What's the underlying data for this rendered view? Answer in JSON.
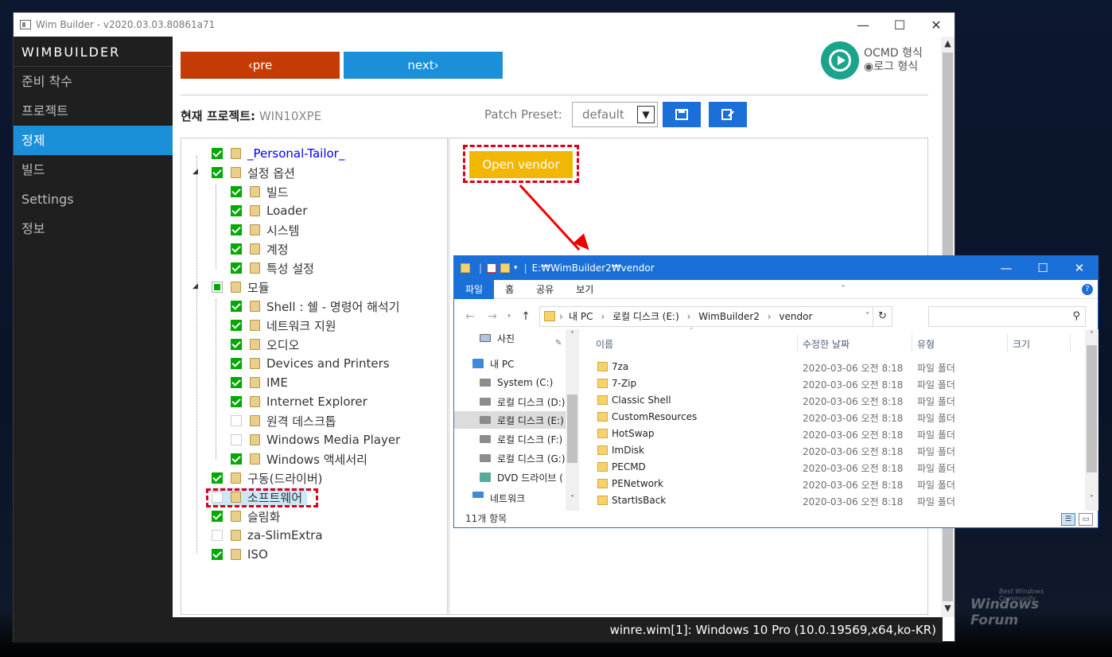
{
  "window": {
    "title": "Wim Builder - v2020.03.03.80861a71",
    "min": "—",
    "max": "☐",
    "close": "✕"
  },
  "sidebar": {
    "brand": "WIMBUILDER",
    "items": [
      {
        "label": "준비 착수"
      },
      {
        "label": "프로젝트"
      },
      {
        "label": "정제"
      },
      {
        "label": "빌드"
      },
      {
        "label": "Settings"
      },
      {
        "label": "정보"
      }
    ],
    "active_index": 2
  },
  "toolbar": {
    "pre_label": "‹pre",
    "next_label": "next›",
    "mode_ocmd": "OCMD 형식",
    "mode_log": "◉로그 형식"
  },
  "project": {
    "label": "현재 프로젝트:",
    "name": "WIN10XPE",
    "preset_label": "Patch Preset:",
    "preset_value": "default",
    "save_icon": "save-icon",
    "edit_icon": "edit-icon"
  },
  "tree": {
    "items": [
      {
        "label": "_Personal-Tailor_",
        "state": "on",
        "level": 0,
        "link": true
      },
      {
        "label": "설정 옵션",
        "state": "on",
        "level": 0
      },
      {
        "label": "빌드",
        "state": "on",
        "level": 1
      },
      {
        "label": "Loader",
        "state": "on",
        "level": 1
      },
      {
        "label": "시스템",
        "state": "on",
        "level": 1
      },
      {
        "label": "계정",
        "state": "on",
        "level": 1
      },
      {
        "label": "특성 설정",
        "state": "on",
        "level": 1
      },
      {
        "label": "모듈",
        "state": "partial",
        "level": 0
      },
      {
        "label": "Shell : 쉘 - 명령어 해석기",
        "state": "on",
        "level": 1
      },
      {
        "label": "네트워크 지원",
        "state": "on",
        "level": 1
      },
      {
        "label": "오디오",
        "state": "on",
        "level": 1
      },
      {
        "label": "Devices and Printers",
        "state": "on",
        "level": 1
      },
      {
        "label": "IME",
        "state": "on",
        "level": 1
      },
      {
        "label": "Internet Explorer",
        "state": "on",
        "level": 1
      },
      {
        "label": "원격 데스크톱",
        "state": "off",
        "level": 1
      },
      {
        "label": "Windows Media Player",
        "state": "off",
        "level": 1
      },
      {
        "label": "Windows 액세서리",
        "state": "on",
        "level": 1
      },
      {
        "label": "구동(드라이버)",
        "state": "on",
        "level": 0
      },
      {
        "label": "소프트웨어",
        "state": "off",
        "level": 0,
        "selected": true
      },
      {
        "label": "슬림화",
        "state": "on",
        "level": 0
      },
      {
        "label": "za-SlimExtra",
        "state": "off",
        "level": 0
      },
      {
        "label": "ISO",
        "state": "on",
        "level": 0
      }
    ]
  },
  "vendor_button": "Open vendor",
  "status": "winre.wim[1]: Windows 10 Pro (10.0.19569,x64,ko-KR)",
  "explorer": {
    "path": "E:₩WimBuilder2₩vendor",
    "tabs": [
      "파일",
      "홈",
      "공유",
      "보기"
    ],
    "breadcrumb": [
      "내 PC",
      "로컬 디스크 (E:)",
      "WimBuilder2",
      "vendor"
    ],
    "nav_items": [
      {
        "label": "사진",
        "icon": "image-icon"
      },
      {
        "label": "내 PC",
        "icon": "pc-icon"
      },
      {
        "label": "System (C:)",
        "icon": "drive-icon"
      },
      {
        "label": "로컬 디스크 (D:)",
        "icon": "drive-icon"
      },
      {
        "label": "로컬 디스크 (E:)",
        "icon": "drive-icon"
      },
      {
        "label": "로컬 디스크 (F:)",
        "icon": "drive-icon"
      },
      {
        "label": "로컬 디스크 (G:)",
        "icon": "drive-icon"
      },
      {
        "label": "DVD 드라이브 (",
        "icon": "dvd-icon"
      },
      {
        "label": "네트워크",
        "icon": "network-icon"
      }
    ],
    "columns": [
      "이름",
      "수정한 날짜",
      "유형",
      "크기"
    ],
    "files": [
      {
        "name": "7za",
        "date": "2020-03-06 오전 8:18",
        "type": "파일 폴더"
      },
      {
        "name": "7-Zip",
        "date": "2020-03-06 오전 8:18",
        "type": "파일 폴더"
      },
      {
        "name": "Classic Shell",
        "date": "2020-03-06 오전 8:18",
        "type": "파일 폴더"
      },
      {
        "name": "CustomResources",
        "date": "2020-03-06 오전 8:18",
        "type": "파일 폴더"
      },
      {
        "name": "HotSwap",
        "date": "2020-03-06 오전 8:18",
        "type": "파일 폴더"
      },
      {
        "name": "ImDisk",
        "date": "2020-03-06 오전 8:18",
        "type": "파일 폴더"
      },
      {
        "name": "PECMD",
        "date": "2020-03-06 오전 8:18",
        "type": "파일 폴더"
      },
      {
        "name": "PENetwork",
        "date": "2020-03-06 오전 8:18",
        "type": "파일 폴더"
      },
      {
        "name": "StartIsBack",
        "date": "2020-03-06 오전 8:18",
        "type": "파일 폴더"
      }
    ],
    "item_count": "11개 항목"
  },
  "watermark": {
    "main": "Windows Forum",
    "sub": "Best Windows Community"
  },
  "colors": {
    "accent": "#1b8fd8",
    "pre": "#c53b05",
    "vendor": "#f2b705",
    "highlight": "#d8001a"
  }
}
